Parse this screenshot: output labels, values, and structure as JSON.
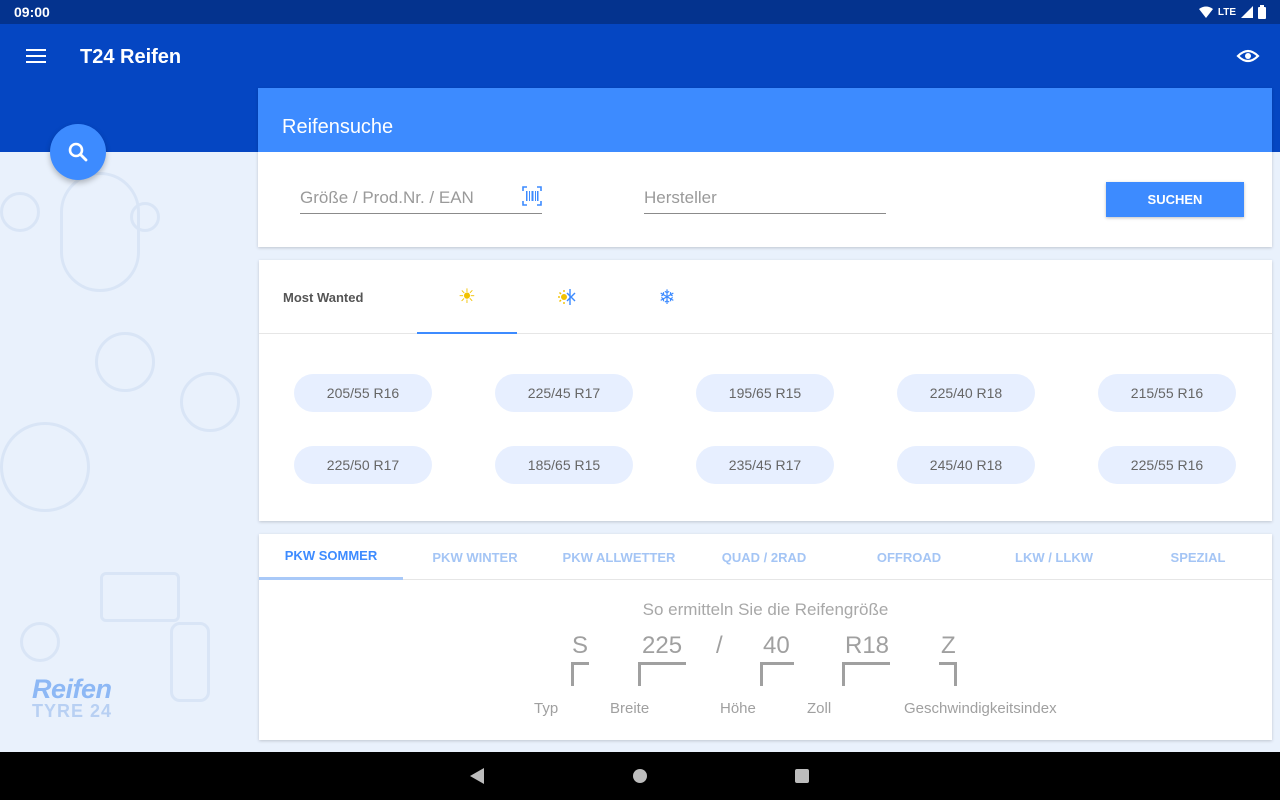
{
  "status": {
    "time": "09:00",
    "network": "LTE"
  },
  "appbar": {
    "title": "T24 Reifen",
    "menu_icon": "menu-icon",
    "eye_icon": "eye-icon"
  },
  "brand": {
    "line1": "Reifen",
    "line2": "TYRE 24"
  },
  "search": {
    "title": "Reifensuche",
    "size_placeholder": "Größe / Prod.Nr. / EAN",
    "maker_placeholder": "Hersteller",
    "button": "SUCHEN"
  },
  "most_wanted": {
    "label": "Most Wanted",
    "season_tabs": [
      "sun-icon",
      "allseason-icon",
      "snowflake-icon"
    ],
    "sizes": [
      "205/55 R16",
      "225/45 R17",
      "195/65 R15",
      "225/40 R18",
      "215/55 R16",
      "225/50 R17",
      "185/65 R15",
      "235/45 R17",
      "245/40 R18",
      "225/55 R16"
    ]
  },
  "categories": [
    "PKW SOMMER",
    "PKW WINTER",
    "PKW ALLWETTER",
    "QUAD / 2RAD",
    "OFFROAD",
    "LKW / LLKW",
    "SPEZIAL"
  ],
  "guide": {
    "title": "So ermitteln Sie die Reifengröße",
    "parts": [
      "S",
      "225",
      "/",
      "40",
      "R18",
      "Z"
    ],
    "labels": [
      "Typ",
      "Breite",
      "Höhe",
      "Zoll",
      "Geschwindigkeitsindex"
    ]
  },
  "colors": {
    "appbar": "#0546c2",
    "accent": "#3d8bff",
    "statusbar": "#04338e"
  }
}
